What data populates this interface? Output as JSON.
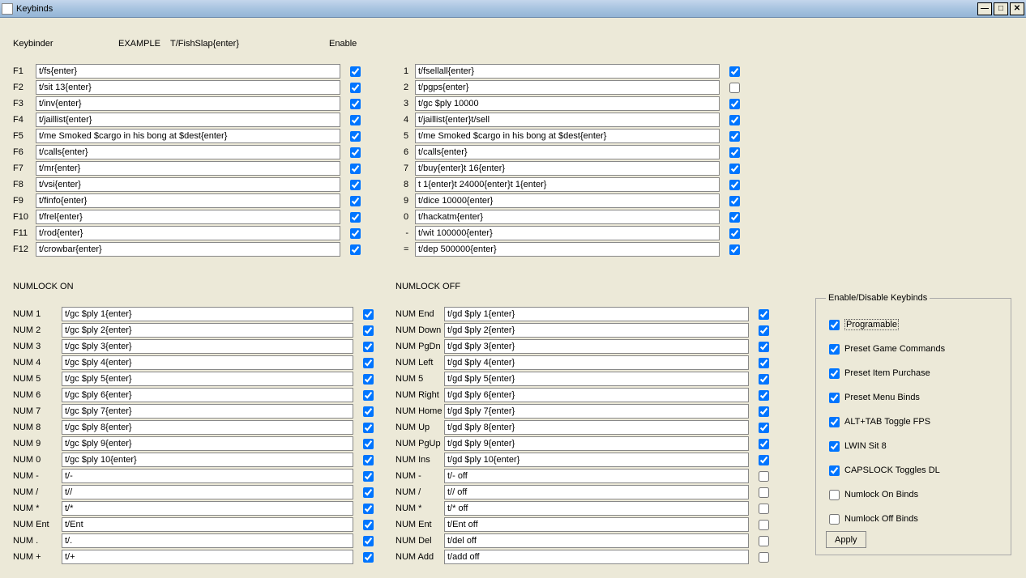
{
  "window": {
    "title": "Keybinds"
  },
  "headers": {
    "keybinder": "Keybinder",
    "example": "EXAMPLE",
    "example_val": "T/FishSlap{enter}",
    "enable": "Enable"
  },
  "left": [
    {
      "k": "F1",
      "v": "t/fs{enter}",
      "c": true
    },
    {
      "k": "F2",
      "v": "t/sit 13{enter}",
      "c": true
    },
    {
      "k": "F3",
      "v": "t/inv{enter}",
      "c": true
    },
    {
      "k": "F4",
      "v": "t/jaillist{enter}",
      "c": true
    },
    {
      "k": "F5",
      "v": "t/me Smoked $cargo in his bong at $dest{enter}",
      "c": true
    },
    {
      "k": "F6",
      "v": "t/calls{enter}",
      "c": true
    },
    {
      "k": "F7",
      "v": "t/mr{enter}",
      "c": true
    },
    {
      "k": "F8",
      "v": "t/vsi{enter}",
      "c": true
    },
    {
      "k": "F9",
      "v": "t/finfo{enter}",
      "c": true
    },
    {
      "k": "F10",
      "v": "t/frel{enter}",
      "c": true
    },
    {
      "k": "F11",
      "v": "t/rod{enter}",
      "c": true
    },
    {
      "k": "F12",
      "v": "t/crowbar{enter}",
      "c": true
    }
  ],
  "right": [
    {
      "k": "1",
      "v": "t/fsellall{enter}",
      "c": true
    },
    {
      "k": "2",
      "v": "t/pgps{enter}",
      "c": false
    },
    {
      "k": "3",
      "v": "t/gc $ply 10000",
      "c": true
    },
    {
      "k": "4",
      "v": "t/jaillist{enter}t/sell",
      "c": true
    },
    {
      "k": "5",
      "v": "t/me Smoked $cargo in his bong at $dest{enter}",
      "c": true
    },
    {
      "k": "6",
      "v": "t/calls{enter}",
      "c": true
    },
    {
      "k": "7",
      "v": "t/buy{enter}t 16{enter}",
      "c": true
    },
    {
      "k": "8",
      "v": "t 1{enter}t 24000{enter}t 1{enter}",
      "c": true
    },
    {
      "k": "9",
      "v": "t/dice 10000{enter}",
      "c": true
    },
    {
      "k": "0",
      "v": "t/hackatm{enter}",
      "c": true
    },
    {
      "k": "-",
      "v": "t/wit 100000{enter}",
      "c": true
    },
    {
      "k": "=",
      "v": "t/dep 500000{enter}",
      "c": true
    }
  ],
  "numlock_on_title": "NUMLOCK ON",
  "numlock_off_title": "NUMLOCK OFF",
  "numon": [
    {
      "k": "NUM 1",
      "v": "t/gc $ply 1{enter}",
      "c": true
    },
    {
      "k": "NUM 2",
      "v": "t/gc $ply 2{enter}",
      "c": true
    },
    {
      "k": "NUM 3",
      "v": "t/gc $ply 3{enter}",
      "c": true
    },
    {
      "k": "NUM 4",
      "v": "t/gc $ply 4{enter}",
      "c": true
    },
    {
      "k": "NUM 5",
      "v": "t/gc $ply 5{enter}",
      "c": true
    },
    {
      "k": "NUM 6",
      "v": "t/gc $ply 6{enter}",
      "c": true
    },
    {
      "k": "NUM 7",
      "v": "t/gc $ply 7{enter}",
      "c": true
    },
    {
      "k": "NUM 8",
      "v": "t/gc $ply 8{enter}",
      "c": true
    },
    {
      "k": "NUM 9",
      "v": "t/gc $ply 9{enter}",
      "c": true
    },
    {
      "k": "NUM 0",
      "v": "t/gc $ply 10{enter}",
      "c": true
    },
    {
      "k": "NUM -",
      "v": "t/-",
      "c": true
    },
    {
      "k": "NUM /",
      "v": "t//",
      "c": true
    },
    {
      "k": "NUM *",
      "v": "t/*",
      "c": true
    },
    {
      "k": "NUM Ent",
      "v": "t/Ent",
      "c": true
    },
    {
      "k": "NUM .",
      "v": "t/.",
      "c": true
    },
    {
      "k": "NUM +",
      "v": "t/+",
      "c": true
    }
  ],
  "numoff": [
    {
      "k": "NUM End",
      "v": "t/gd $ply 1{enter}",
      "c": true
    },
    {
      "k": "NUM Down",
      "v": "t/gd $ply 2{enter}",
      "c": true
    },
    {
      "k": "NUM PgDn",
      "v": "t/gd $ply 3{enter}",
      "c": true
    },
    {
      "k": "NUM Left",
      "v": "t/gd $ply 4{enter}",
      "c": true
    },
    {
      "k": "NUM 5",
      "v": "t/gd $ply 5{enter}",
      "c": true
    },
    {
      "k": "NUM Right",
      "v": "t/gd $ply 6{enter}",
      "c": true
    },
    {
      "k": "NUM Home",
      "v": "t/gd $ply 7{enter}",
      "c": true
    },
    {
      "k": "NUM Up",
      "v": "t/gd $ply 8{enter}",
      "c": true
    },
    {
      "k": "NUM PgUp",
      "v": "t/gd $ply 9{enter}",
      "c": true
    },
    {
      "k": "NUM Ins",
      "v": "t/gd $ply 10{enter}",
      "c": true
    },
    {
      "k": "NUM -",
      "v": "t/- off",
      "c": false
    },
    {
      "k": "NUM /",
      "v": "t// off",
      "c": false
    },
    {
      "k": "NUM *",
      "v": "t/* off",
      "c": false
    },
    {
      "k": "NUM Ent",
      "v": "t/Ent off",
      "c": false
    },
    {
      "k": "NUM Del",
      "v": "t/del off",
      "c": false
    },
    {
      "k": "NUM Add",
      "v": "t/add off",
      "c": false
    }
  ],
  "group": {
    "title": "Enable/Disable Keybinds",
    "opts": [
      {
        "label": "Programable",
        "c": true,
        "dotted": true
      },
      {
        "label": "Preset Game Commands",
        "c": true
      },
      {
        "label": "Preset Item Purchase",
        "c": true
      },
      {
        "label": "Preset Menu Binds",
        "c": true
      },
      {
        "label": "ALT+TAB Toggle FPS",
        "c": true
      },
      {
        "label": "LWIN Sit 8",
        "c": true
      },
      {
        "label": "CAPSLOCK Toggles DL",
        "c": true
      },
      {
        "label": "Numlock On Binds",
        "c": false
      },
      {
        "label": "Numlock Off Binds",
        "c": false
      }
    ],
    "apply": "Apply"
  }
}
